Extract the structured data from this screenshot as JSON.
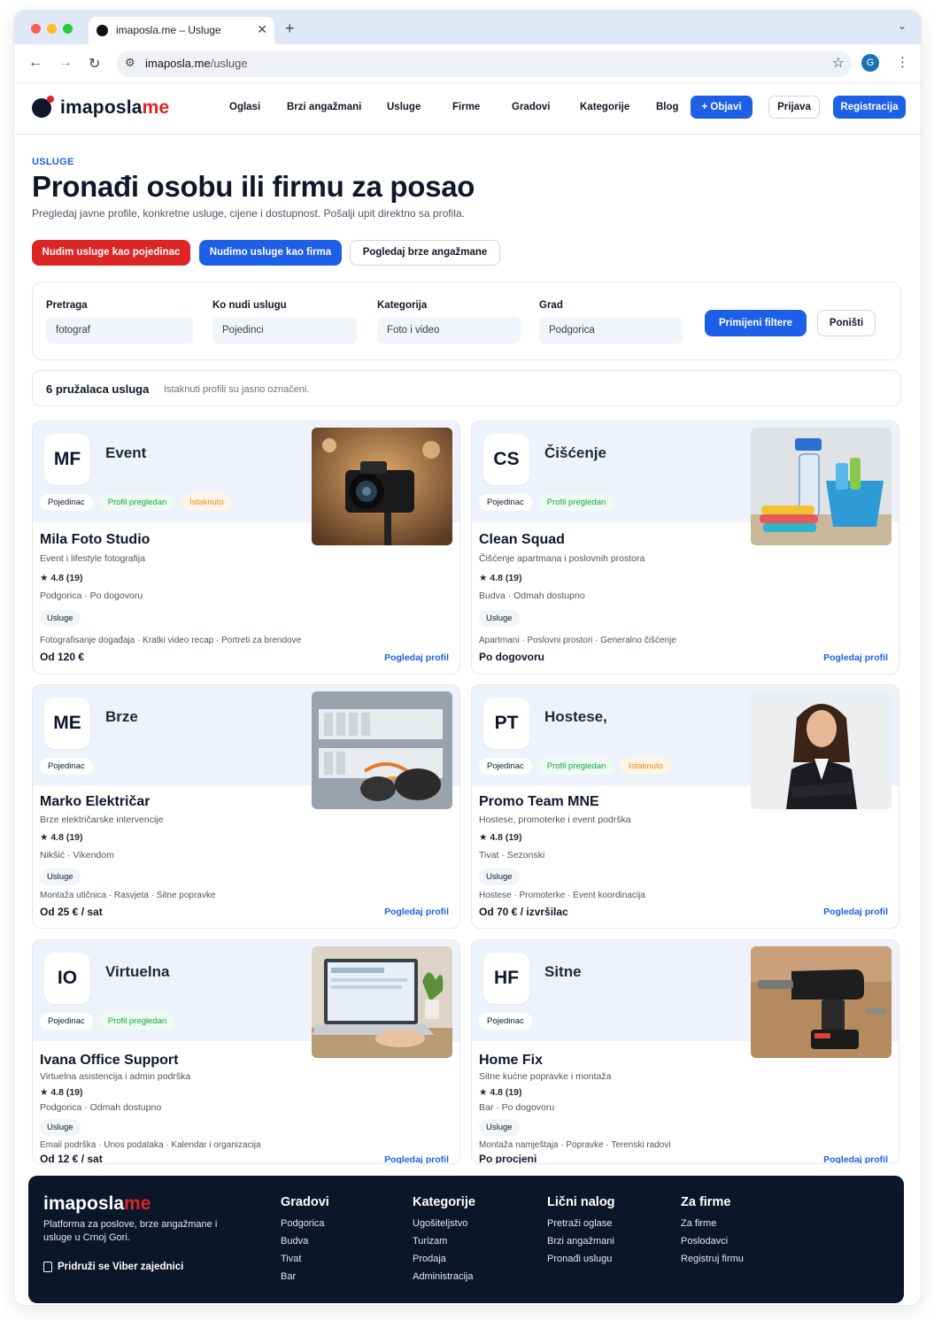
{
  "browser": {
    "tab_title": "imaposla.me – Usluge",
    "url_domain": "imaposla.me",
    "url_path": "/usluge",
    "profile_initial": "G"
  },
  "header": {
    "logo_main": "imaposla",
    "logo_accent": "me",
    "menu": [
      "Oglasi",
      "Brzi angažmani",
      "Usluge",
      "Firme",
      "Gradovi",
      "Kategorije",
      "Blog"
    ],
    "post_button": "+ Objavi",
    "login_button": "Prijava",
    "register_button": "Registracija"
  },
  "hero": {
    "eyebrow": "USLUGE",
    "title": "Pronađi osobu ili firmu za posao",
    "subtitle": "Pregledaj javne profile, konkretne usluge, cijene i dostupnost. Pošalji upit direktno sa profila.",
    "cta_individual": "Nudim usluge kao pojedinac",
    "cta_company": "Nudimo usluge kao firma",
    "cta_quick": "Pogledaj brze angažmane"
  },
  "filters": {
    "search_label": "Pretraga",
    "search_value": "fotograf",
    "provider_label": "Ko nudi uslugu",
    "provider_value": "Pojedinci",
    "category_label": "Kategorija",
    "category_value": "Foto i video",
    "city_label": "Grad",
    "city_value": "Podgorica",
    "apply_button": "Primijeni filtere",
    "reset_button": "Poništi"
  },
  "results": {
    "count": "6 pružalaca usluga",
    "note": "Istaknuti profili su jasno označeni."
  },
  "cards": [
    {
      "initials": "MF",
      "category_word": "Event",
      "badges": [
        "Pojedinac",
        "Profil pregledan",
        "Istaknuto"
      ],
      "name": "Mila Foto Studio",
      "desc": "Event i lifestyle fotografija",
      "rating": "★ 4.8 (19)",
      "location": "Podgorica · Po dogovoru",
      "tag": "Usluge",
      "tags_line": "Fotografisanje događaja · Kratki video recap · Portreti za brendove",
      "price": "Od 120 €",
      "link": "Pogledaj profil",
      "image_icon": "camera-photo"
    },
    {
      "initials": "CS",
      "category_word": "Čišćenje",
      "badges": [
        "Pojedinac",
        "Profil pregledan"
      ],
      "name": "Clean Squad",
      "desc": "Čišćenje apartmana i poslovnih prostora",
      "rating": "★ 4.8 (19)",
      "location": "Budva · Odmah dostupno",
      "tag": "Usluge",
      "tags_line": "Apartmani · Poslovni prostori · Generalno čišćenje",
      "price": "Po dogovoru",
      "link": "Pogledaj profil",
      "image_icon": "cleaning-supplies-photo"
    },
    {
      "initials": "ME",
      "category_word": "Brze",
      "badges": [
        "Pojedinac"
      ],
      "name": "Marko Električar",
      "desc": "Brze električarske intervencije",
      "rating": "★ 4.8 (19)",
      "location": "Nikšić · Vikendom",
      "tag": "Usluge",
      "tags_line": "Montaža utičnica · Rasvjeta · Sitne popravke",
      "price": "Od 25 € / sat",
      "link": "Pogledaj profil",
      "image_icon": "electrician-photo"
    },
    {
      "initials": "PT",
      "category_word": "Hostese,",
      "badges": [
        "Pojedinac",
        "Profil pregledan",
        "Istaknuto"
      ],
      "name": "Promo Team MNE",
      "desc": "Hostese, promoterke i event podrška",
      "rating": "★ 4.8 (19)",
      "location": "Tivat · Sezonski",
      "tag": "Usluge",
      "tags_line": "Hostese · Promoterke · Event koordinacija",
      "price": "Od 70 € / izvršilac",
      "link": "Pogledaj profil",
      "image_icon": "hostess-photo"
    },
    {
      "initials": "IO",
      "category_word": "Virtuelna",
      "badges": [
        "Pojedinac",
        "Profil pregledan"
      ],
      "name": "Ivana Office Support",
      "desc": "Virtuelna asistencija i admin podrška",
      "rating": "★ 4.8 (19)",
      "location": "Podgorica · Odmah dostupno",
      "tag": "Usluge",
      "tags_line": "Email podrška · Unos podataka · Kalendar i organizacija",
      "price": "Od 12 € / sat",
      "link": "Pogledaj profil",
      "image_icon": "laptop-photo"
    },
    {
      "initials": "HF",
      "category_word": "Sitne",
      "badges": [
        "Pojedinac"
      ],
      "name": "Home Fix",
      "desc": "Sitne kućne popravke i montaža",
      "rating": "★ 4.8 (19)",
      "location": "Bar · Po dogovoru",
      "tag": "Usluge",
      "tags_line": "Montaža namještaja · Popravke · Terenski radovi",
      "price": "Po procjeni",
      "link": "Pogledaj profil",
      "image_icon": "drill-photo"
    }
  ],
  "footer": {
    "logo_main": "imaposla",
    "logo_accent": "me",
    "tagline": "Platforma za poslove, brze angažmane i usluge u Crnoj Gori.",
    "viber_link": "Pridruži se Viber zajednici",
    "columns": [
      {
        "title": "Gradovi",
        "links": [
          "Podgorica",
          "Budva",
          "Tivat",
          "Bar"
        ]
      },
      {
        "title": "Kategorije",
        "links": [
          "Ugošiteljstvo",
          "Turizam",
          "Prodaja",
          "Administracija"
        ]
      },
      {
        "title": "Lični nalog",
        "links": [
          "Pretraži oglase",
          "Brzi angažmani",
          "Pronađi uslugu"
        ]
      },
      {
        "title": "Za firme",
        "links": [
          "Za firme",
          "Poslodavci",
          "Registruj firmu"
        ]
      }
    ]
  },
  "colors": {
    "primary_blue": "#1d5fe6",
    "accent_red": "#dc2626",
    "footer_bg": "#0b1729",
    "badge_green": "#16a34a",
    "badge_orange": "#ea8a1a"
  }
}
